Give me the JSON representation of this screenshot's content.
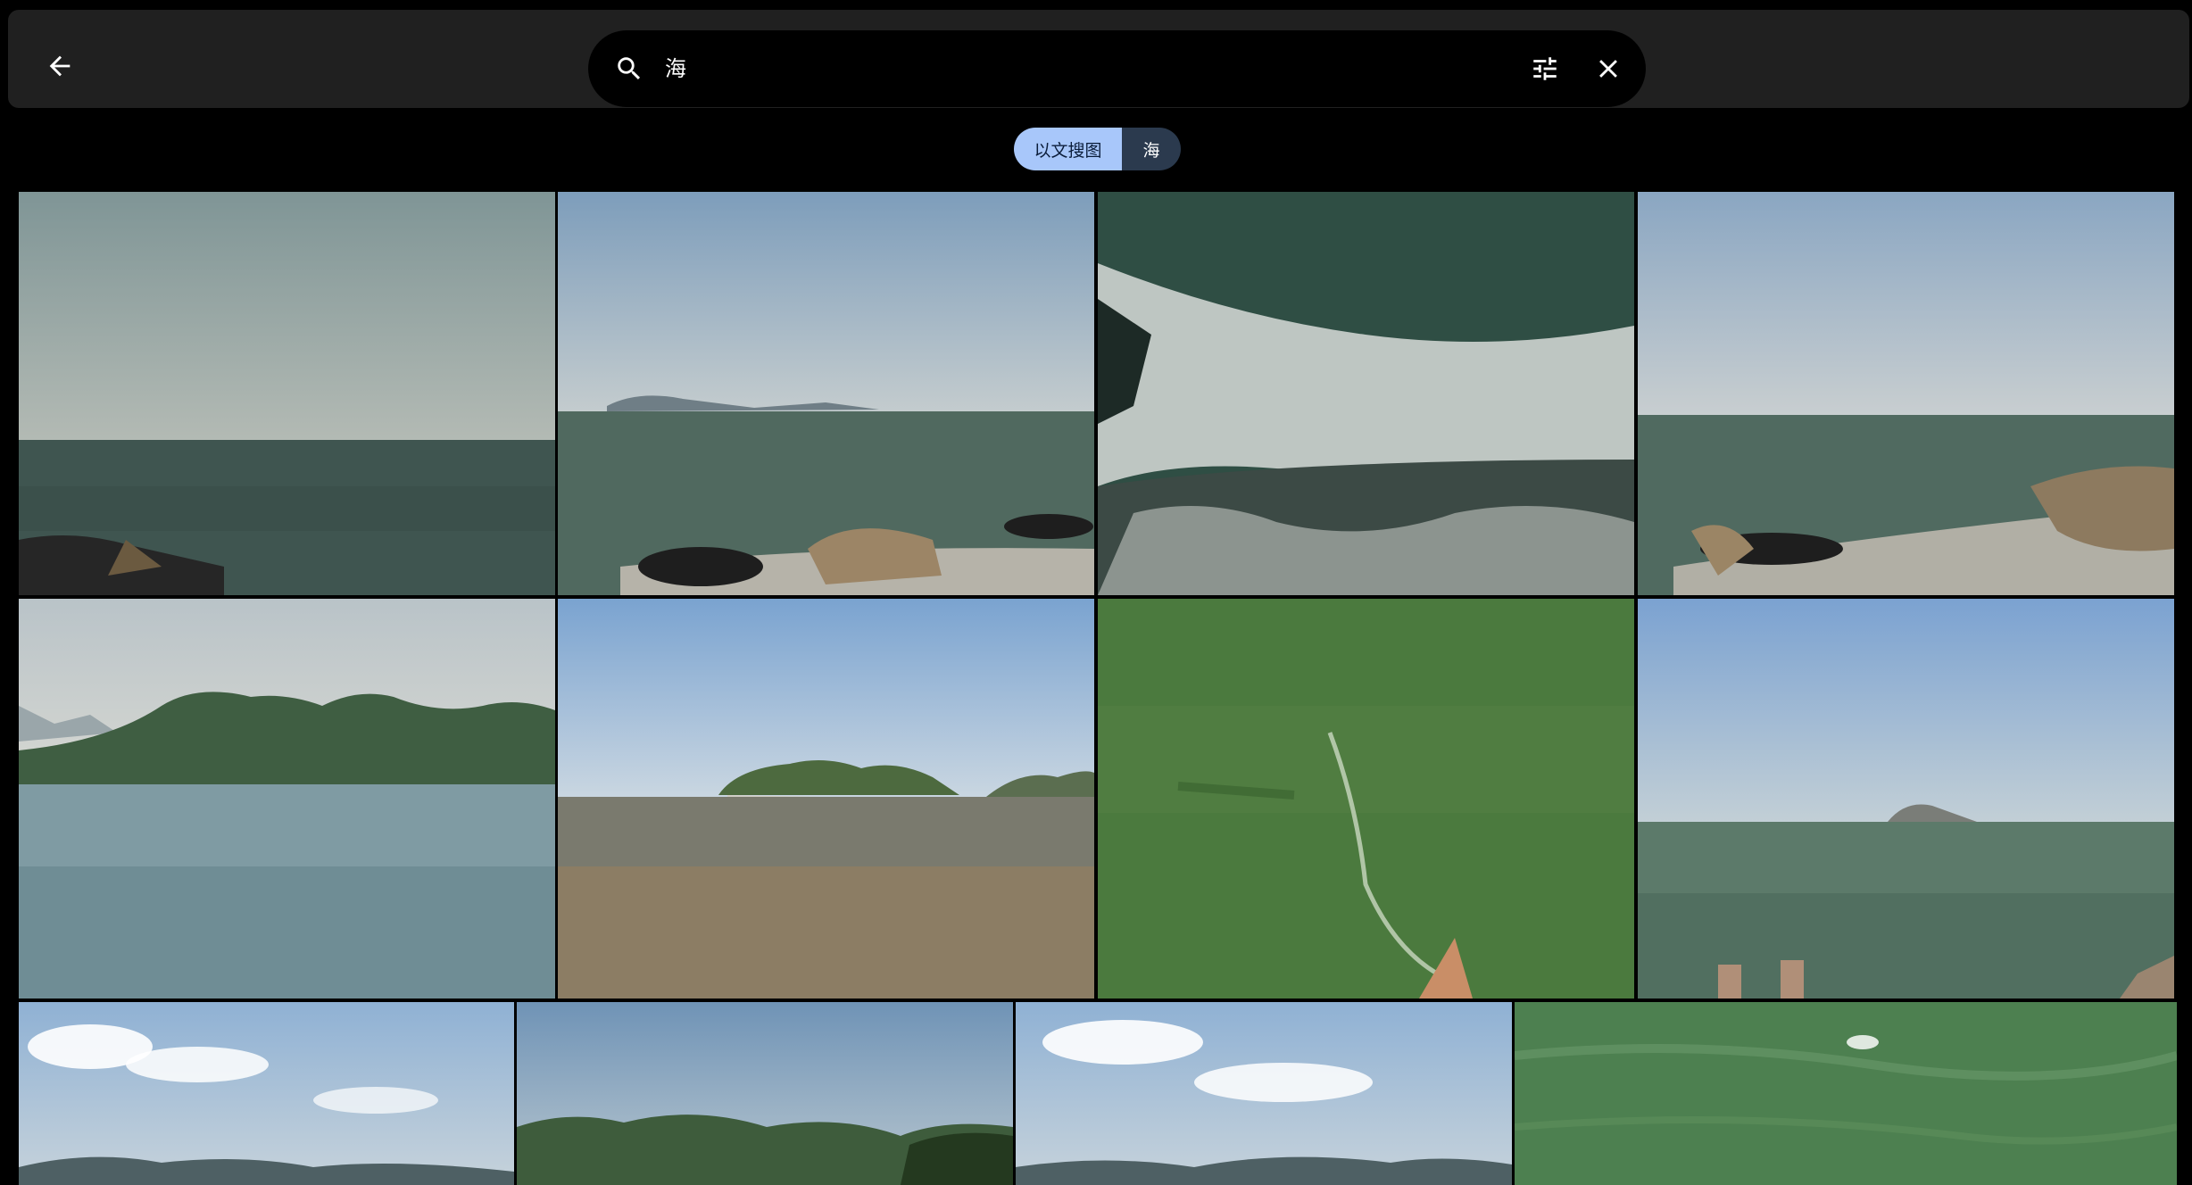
{
  "toolbar": {
    "back_icon": "arrow-back-icon"
  },
  "search": {
    "query": "海",
    "placeholder": "",
    "search_icon": "search-icon",
    "filter_icon": "tune-icon",
    "close_icon": "close-icon"
  },
  "chips": {
    "mode_label": "以文搜图",
    "query_label": "海"
  },
  "colors": {
    "topbar": "#202020",
    "search_field": "#000000",
    "chip_active": "#a8c7fa",
    "chip_query": "#2b3a4e",
    "background": "#000000"
  },
  "results": {
    "scenes": [
      "open-sea-hazy-horizon",
      "sea-distant-island-boat-deck",
      "splashing-waves",
      "sea-boat-deck-ropes",
      "green-hills-lake",
      "rocky-islet-sea",
      "green-water-wake",
      "sea-small-island-bollards",
      "clouds-over-mountains",
      "wooded-hills-shore",
      "clouds-over-mountains",
      "green-water-surface"
    ]
  }
}
